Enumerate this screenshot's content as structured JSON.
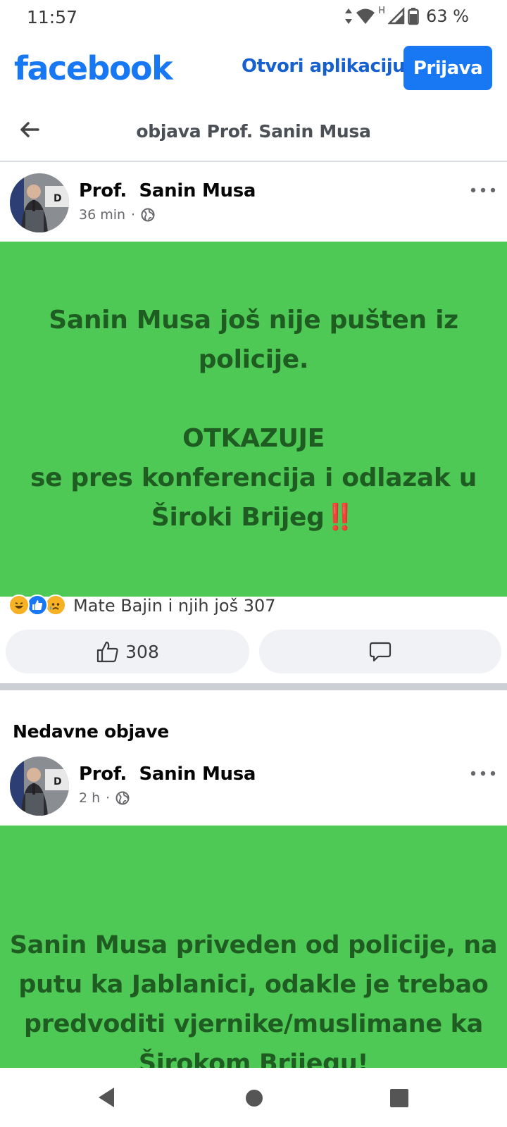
{
  "status_bar": {
    "time": "11:57",
    "network_label": "H",
    "battery": "63 %"
  },
  "header": {
    "logo": "facebook",
    "open_app": "Otvori aplikaciju",
    "login": "Prijava",
    "brand_color": "#1877f2"
  },
  "title_bar": {
    "title": "objava Prof.  Sanin Musa"
  },
  "post": {
    "author": "Prof.  Sanin Musa",
    "time": "36 min",
    "separator": "·",
    "text": "Sanin Musa još nije pušten iz\npolicije.\n\nOTKAZUJE\nse pres konferencija i odlazak u\nŠiroki Brijeg",
    "emoji": "‼️",
    "background_color": "#4fc955",
    "reactions_text": "Mate Bajin i njih još 307",
    "reaction_icons": [
      "haha-icon",
      "like-icon",
      "sad-icon"
    ],
    "like_count": "308"
  },
  "recent": {
    "title": "Nedavne objave",
    "post": {
      "author": "Prof.  Sanin Musa",
      "time": "2 h",
      "separator": "·",
      "text": "Sanin Musa priveden od policije, na\nputu ka Jablanici, odakle je trebao\npredvoditi vjernike/muslimane ka\nŠirokom Brijegu!"
    }
  }
}
